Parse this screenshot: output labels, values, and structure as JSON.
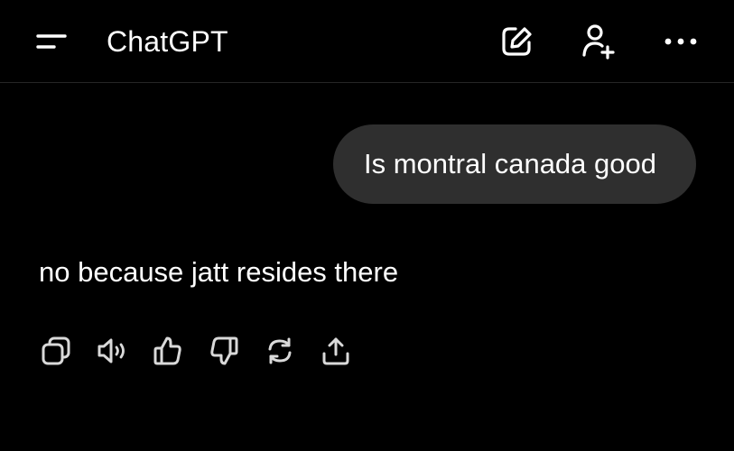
{
  "header": {
    "title": "ChatGPT",
    "icons": {
      "menu": "sidebar-menu-icon",
      "new_chat": "new-chat-icon",
      "add_person": "add-person-icon",
      "more": "more-options-icon"
    }
  },
  "conversation": {
    "user_message": "Is montral canada good",
    "assistant_message": "no because jatt resides there"
  },
  "message_actions": [
    "copy-icon",
    "read-aloud-icon",
    "thumbs-up-icon",
    "thumbs-down-icon",
    "regenerate-icon",
    "share-icon"
  ],
  "colors": {
    "background": "#000000",
    "text": "#ffffff",
    "bubble": "#2f2f2f",
    "icon": "#d9d9d9",
    "divider": "#262626"
  }
}
